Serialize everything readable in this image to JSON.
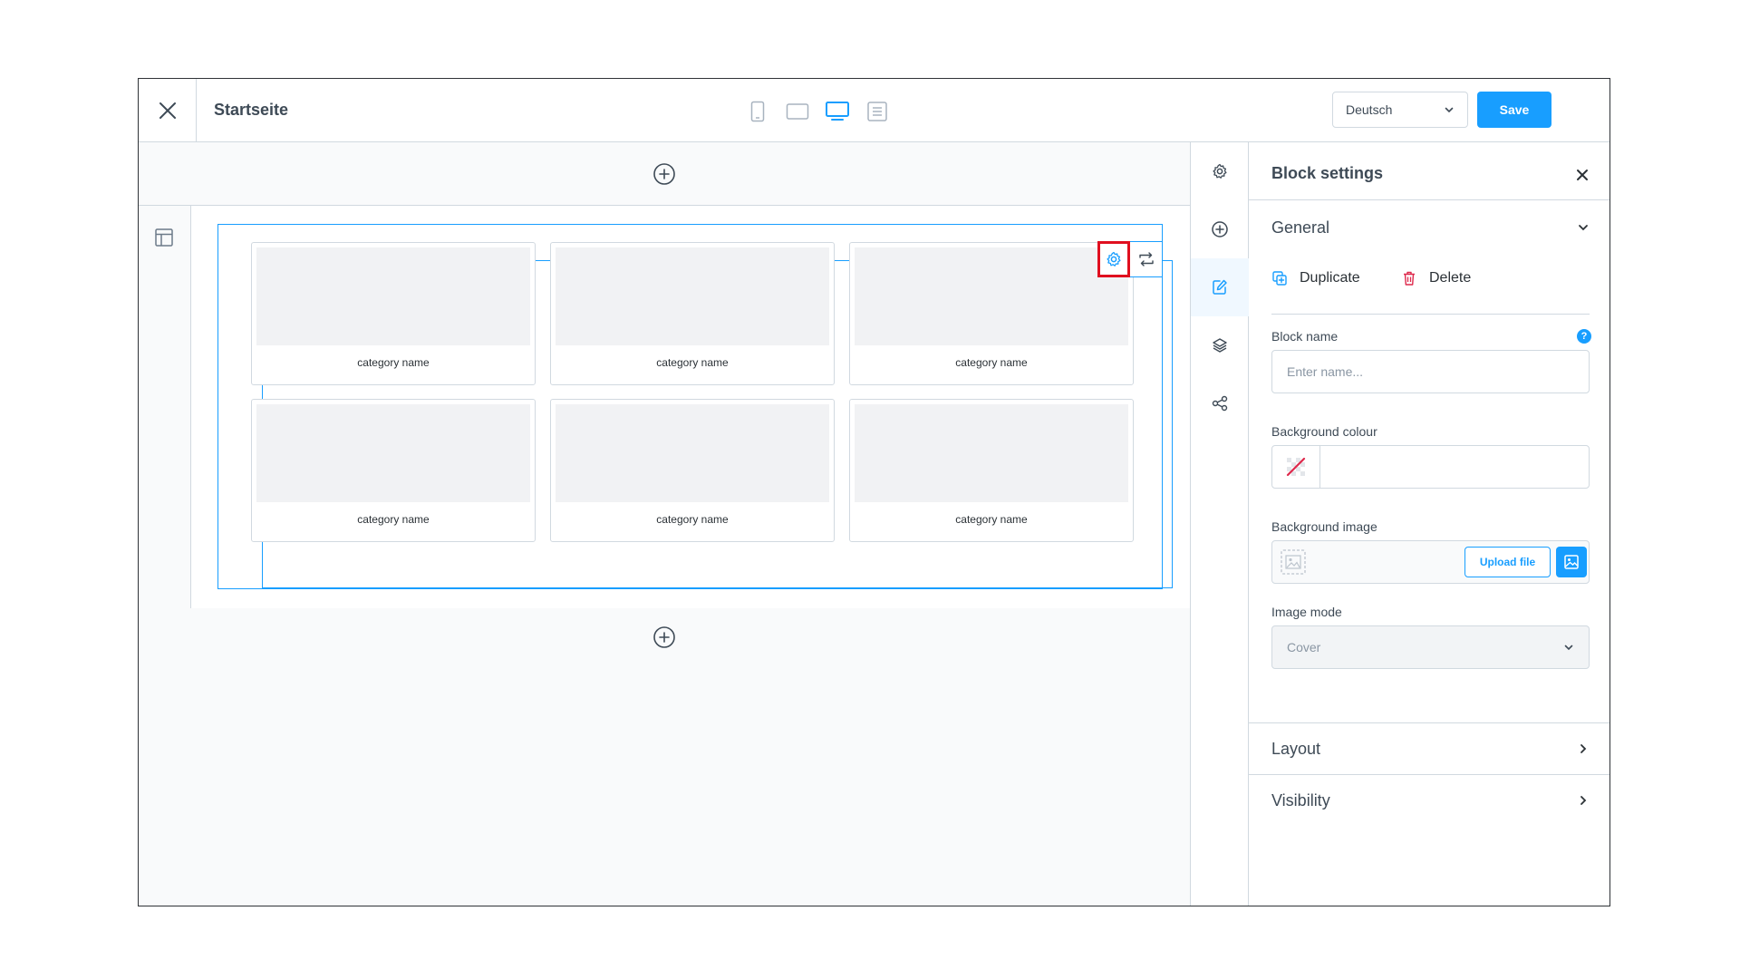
{
  "topbar": {
    "title": "Startseite",
    "language": "Deutsch",
    "save_label": "Save"
  },
  "canvas": {
    "cards": [
      {
        "label": "category name"
      },
      {
        "label": "category name"
      },
      {
        "label": "category name"
      },
      {
        "label": "category name"
      },
      {
        "label": "category name"
      },
      {
        "label": "category name"
      }
    ]
  },
  "panel": {
    "title": "Block settings",
    "sections": {
      "general": "General",
      "layout": "Layout",
      "visibility": "Visibility"
    },
    "duplicate_label": "Duplicate",
    "delete_label": "Delete",
    "help_glyph": "?",
    "block_name": {
      "label": "Block name",
      "placeholder": "Enter name...",
      "value": ""
    },
    "background_colour": {
      "label": "Background colour",
      "value": ""
    },
    "background_image": {
      "label": "Background image",
      "upload_label": "Upload file"
    },
    "image_mode": {
      "label": "Image mode",
      "value": "Cover"
    }
  },
  "colors": {
    "accent": "#189eff",
    "danger": "#de294c",
    "highlight": "#e00f1f"
  }
}
